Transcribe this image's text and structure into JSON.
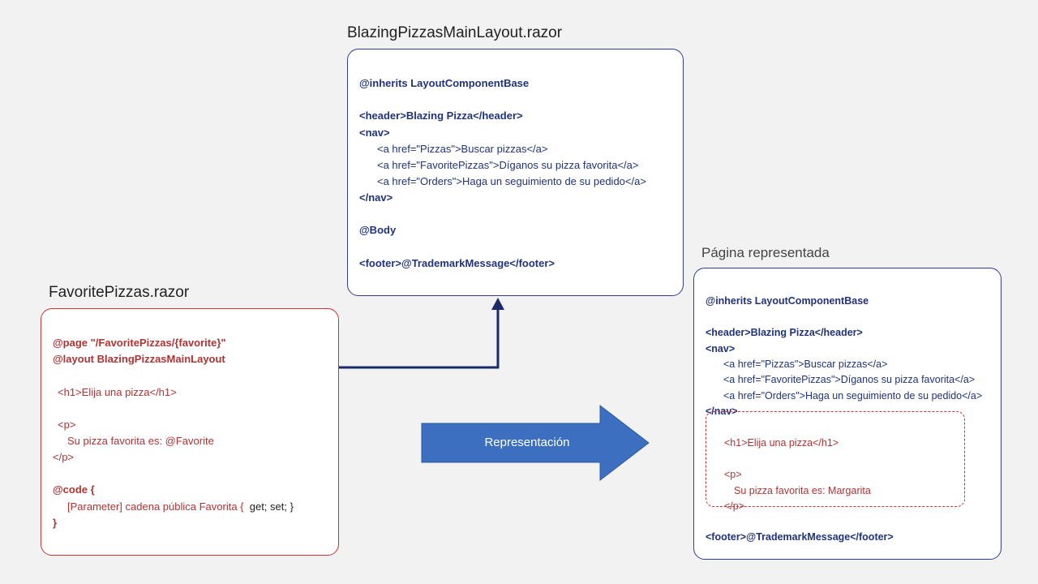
{
  "layoutBox": {
    "title": "BlazingPizzasMainLayout.razor",
    "inherits": "@inherits LayoutComponentBase",
    "headerLine": "<header>Blazing Pizza</header>",
    "navOpen": "<nav>",
    "navLink1": "<a href=\"Pizzas\">Buscar pizzas</a>",
    "navLink2": "<a href=\"FavoritePizzas\">Díganos su pizza favorita</a>",
    "navLink3": "<a href=\"Orders\">Haga un seguimiento de su pedido</a>",
    "navClose": "</nav>",
    "body": "@Body",
    "footer": "<footer>@TrademarkMessage</footer>"
  },
  "favBox": {
    "title": "FavoritePizzas.razor",
    "page": "@page \"/FavoritePizzas/{favorite}\"",
    "layout": "@layout BlazingPizzasMainLayout",
    "h1": "<h1>Elija una pizza</h1>",
    "pOpen": "<p>",
    "pContent": "Su pizza favorita es: @Favorite",
    "pClose": "</p>",
    "codeOpen": "@code {",
    "paramPrefix": "[Parameter] cadena pública Favorita {",
    "paramSuffix": "  get; set; }",
    "codeClose": "}"
  },
  "renderedBox": {
    "title": "Página representada",
    "inherits": "@inherits LayoutComponentBase",
    "headerLine": "<header>Blazing Pizza</header>",
    "navOpen": "<nav>",
    "navLink1": "<a href=\"Pizzas\">Buscar pizzas</a>",
    "navLink2": "<a href=\"FavoritePizzas\">Díganos su pizza favorita</a>",
    "navLink3": "<a href=\"Orders\">Haga un seguimiento de su pedido</a>",
    "navClose": "</nav>",
    "footer": "<footer>@TrademarkMessage</footer>",
    "inset": {
      "h1": "<h1>Elija una pizza</h1>",
      "pOpen": "<p>",
      "pContent": "Su pizza favorita es: Margarita",
      "pClose": "</p>"
    }
  },
  "arrow": {
    "label": "Representación"
  }
}
